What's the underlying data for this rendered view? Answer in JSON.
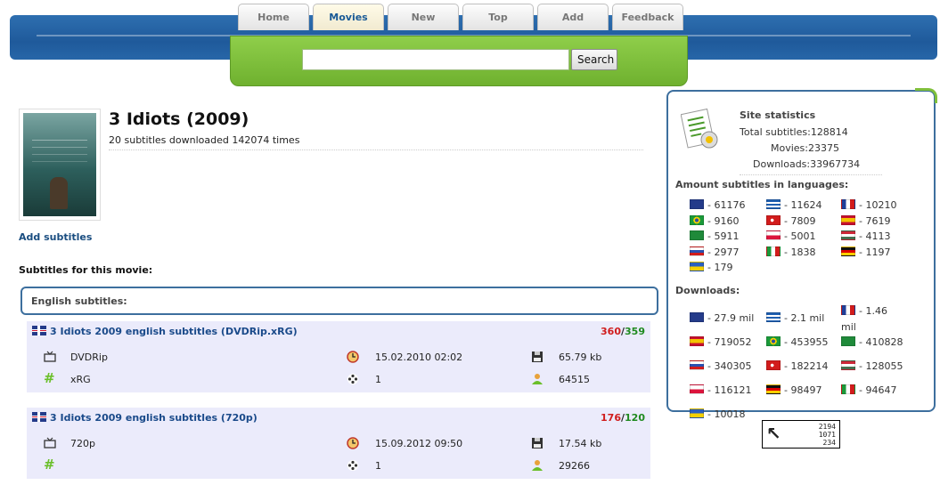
{
  "nav": {
    "tabs": [
      "Home",
      "Movies",
      "New",
      "Top",
      "Add",
      "Feedback"
    ],
    "active": "Movies"
  },
  "search": {
    "value": "",
    "button": "Search"
  },
  "movie": {
    "title": "3 Idiots (2009)",
    "summary": "20 subtitles downloaded 142074 times",
    "add_link": "Add subtitles",
    "list_heading": "Subtitles for this movie:",
    "language_heading": "English subtitles:"
  },
  "subtitles": [
    {
      "title": "3 Idiots 2009 english subtitles (DVDRip.xRG)",
      "votes_bad": "360",
      "votes_good": "359",
      "release": "DVDRip",
      "group": "xRG",
      "date": "15.02.2010 02:02",
      "cds": "1",
      "size": "65.79 kb",
      "downloads": "64515"
    },
    {
      "title": "3 Idiots 2009 english subtitles (720p)",
      "votes_bad": "176",
      "votes_good": "120",
      "release": "720p",
      "group": "",
      "date": "15.09.2012 09:50",
      "cds": "1",
      "size": "17.54 kb",
      "downloads": "29266"
    }
  ],
  "stats": {
    "heading": "Site statistics",
    "total": "Total subtitles:128814",
    "movies": "Movies:23375",
    "downloads": "Downloads:33967734",
    "languages_heading": "Amount subtitles in languages:",
    "languages": [
      {
        "flag": "uk",
        "value": "- 61176"
      },
      {
        "flag": "gr",
        "value": "- 11624"
      },
      {
        "flag": "fr",
        "value": "- 10210"
      },
      {
        "flag": "br",
        "value": "- 9160"
      },
      {
        "flag": "tr",
        "value": "- 7809"
      },
      {
        "flag": "es",
        "value": "- 7619"
      },
      {
        "flag": "ar",
        "value": "- 5911"
      },
      {
        "flag": "pl",
        "value": "- 5001"
      },
      {
        "flag": "hu",
        "value": "- 4113"
      },
      {
        "flag": "ru",
        "value": "- 2977"
      },
      {
        "flag": "it",
        "value": "- 1838"
      },
      {
        "flag": "de",
        "value": "- 1197"
      },
      {
        "flag": "ua",
        "value": "- 179"
      }
    ],
    "downloads_heading": "Downloads:",
    "downloads_by_lang": [
      {
        "flag": "uk",
        "value": "- 27.9 mil"
      },
      {
        "flag": "gr",
        "value": "- 2.1 mil"
      },
      {
        "flag": "fr",
        "value": "- 1.46 mil"
      },
      {
        "flag": "es",
        "value": "- 719052"
      },
      {
        "flag": "br",
        "value": "- 453955"
      },
      {
        "flag": "ar",
        "value": "- 410828"
      },
      {
        "flag": "ru",
        "value": "- 340305"
      },
      {
        "flag": "tr",
        "value": "- 182214"
      },
      {
        "flag": "hu",
        "value": "- 128055"
      },
      {
        "flag": "pl",
        "value": "- 116121"
      },
      {
        "flag": "de",
        "value": "- 98497"
      },
      {
        "flag": "it",
        "value": "- 94647"
      },
      {
        "flag": "ua",
        "value": "- 10018"
      }
    ]
  },
  "counter": {
    "line1": "2194",
    "line2": "1071",
    "line3": "234"
  }
}
